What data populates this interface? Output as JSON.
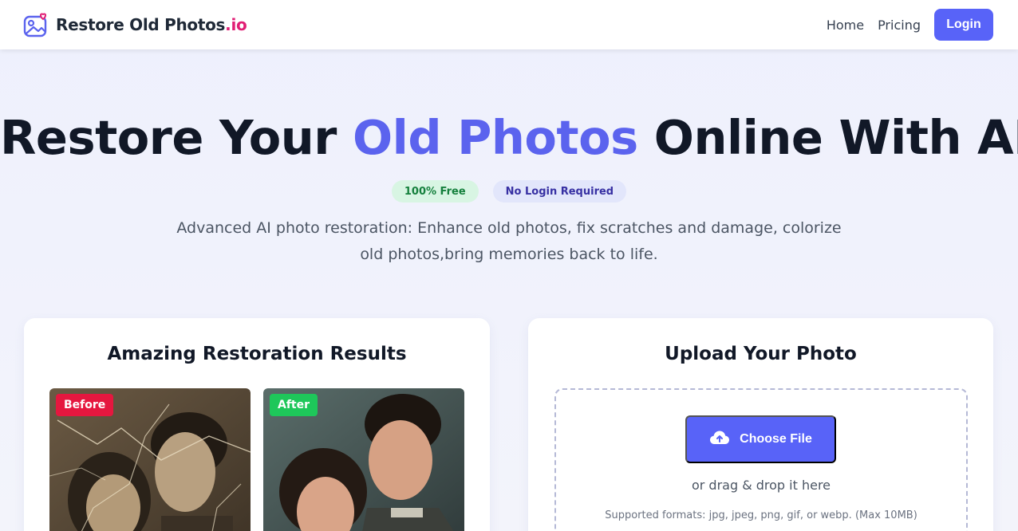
{
  "brand": {
    "name": "Restore Old Photos",
    "tld": ".io",
    "logo_icon": "photo-heart-icon"
  },
  "nav": {
    "home": "Home",
    "pricing": "Pricing",
    "login": "Login"
  },
  "hero": {
    "title_part1": "Restore Your",
    "title_accent": "Old Photos",
    "title_part2": "Online With AI",
    "badge_free": "100% Free",
    "badge_nologin": "No Login Required",
    "description": "Advanced AI photo restoration: Enhance old photos, fix scratches and damage, colorize old photos,bring memories back to life."
  },
  "results": {
    "title": "Amazing Restoration Results",
    "before_label": "Before",
    "after_label": "After"
  },
  "upload": {
    "title": "Upload Your Photo",
    "button_label": "Choose File",
    "button_icon": "cloud-upload-icon",
    "drag_text": "or drag & drop it here",
    "formats_text": "Supported formats: jpg, jpeg, png, gif, or webp. (Max 10MB)"
  },
  "colors": {
    "accent": "#5b63ee",
    "brand_tld": "#e11d74",
    "primary_button": "#5863f8",
    "before_tag": "#e5173f",
    "after_tag": "#1ec75a"
  }
}
